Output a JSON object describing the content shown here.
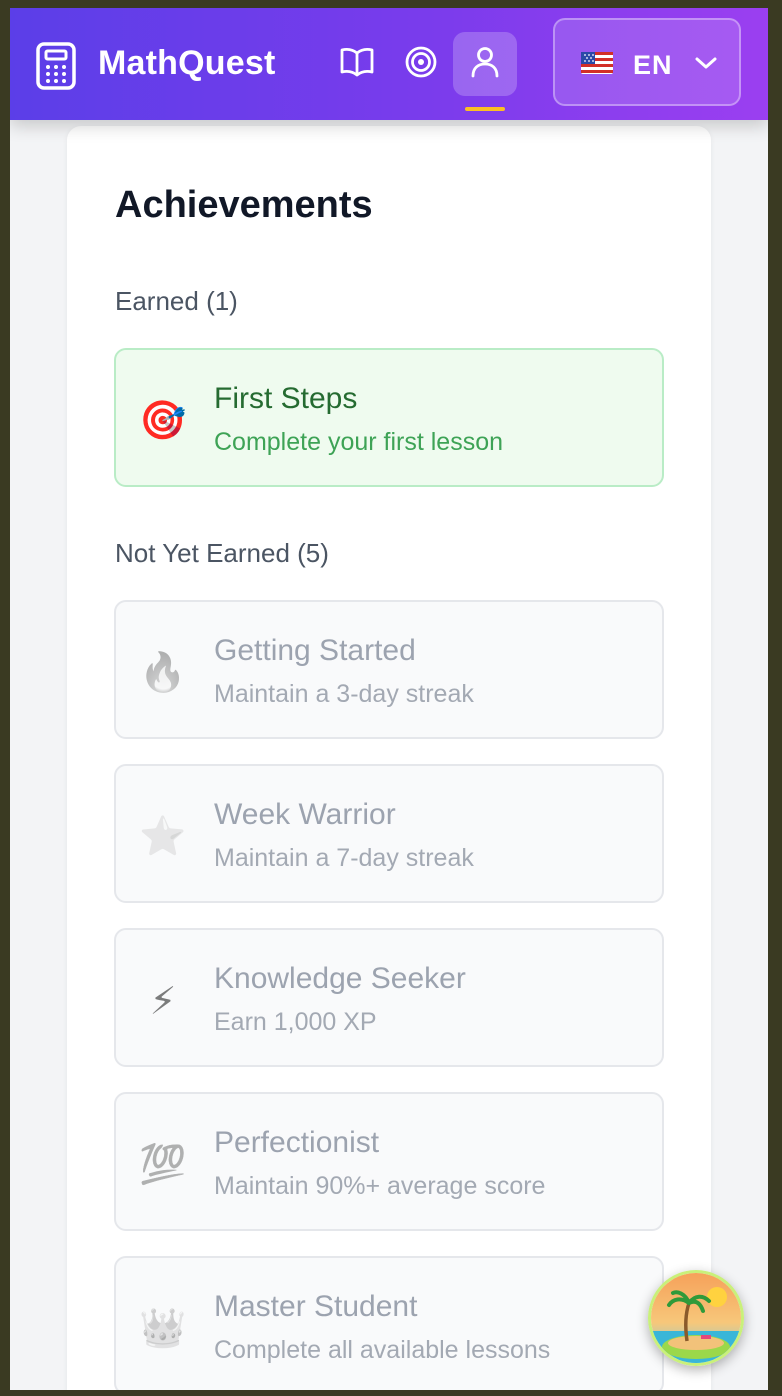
{
  "header": {
    "app_title": "MathQuest",
    "logo_icon": "calculator-icon",
    "nav": [
      {
        "name": "lessons",
        "icon": "book-open-icon",
        "active": false
      },
      {
        "name": "goals",
        "icon": "target-icon",
        "active": false
      },
      {
        "name": "profile",
        "icon": "user-icon",
        "active": true
      }
    ],
    "language": {
      "flag": "us-flag-icon",
      "code": "EN",
      "chevron": "chevron-down-icon"
    },
    "accent": "#fbbf24",
    "gradient": [
      "#5b3ee8",
      "#9b3ff0"
    ]
  },
  "achievements": {
    "title": "Achievements",
    "earned_label": "Earned (1)",
    "not_earned_label": "Not Yet Earned (5)",
    "earned": [
      {
        "icon": "🎯",
        "icon_name": "dart-target-icon",
        "name": "First Steps",
        "desc": "Complete your first lesson"
      }
    ],
    "locked": [
      {
        "icon": "🔥",
        "icon_name": "fire-icon",
        "name": "Getting Started",
        "desc": "Maintain a 3-day streak"
      },
      {
        "icon": "⭐",
        "icon_name": "star-icon",
        "name": "Week Warrior",
        "desc": "Maintain a 7-day streak"
      },
      {
        "icon": "⚡",
        "icon_name": "lightning-icon",
        "name": "Knowledge Seeker",
        "desc": "Earn 1,000 XP"
      },
      {
        "icon": "💯",
        "icon_name": "hundred-points-icon",
        "name": "Perfectionist",
        "desc": "Maintain 90%+ average score"
      },
      {
        "icon": "👑",
        "icon_name": "crown-icon",
        "name": "Master Student",
        "desc": "Complete all available lessons"
      }
    ]
  },
  "floating_button": {
    "icon": "beach-island-icon"
  }
}
